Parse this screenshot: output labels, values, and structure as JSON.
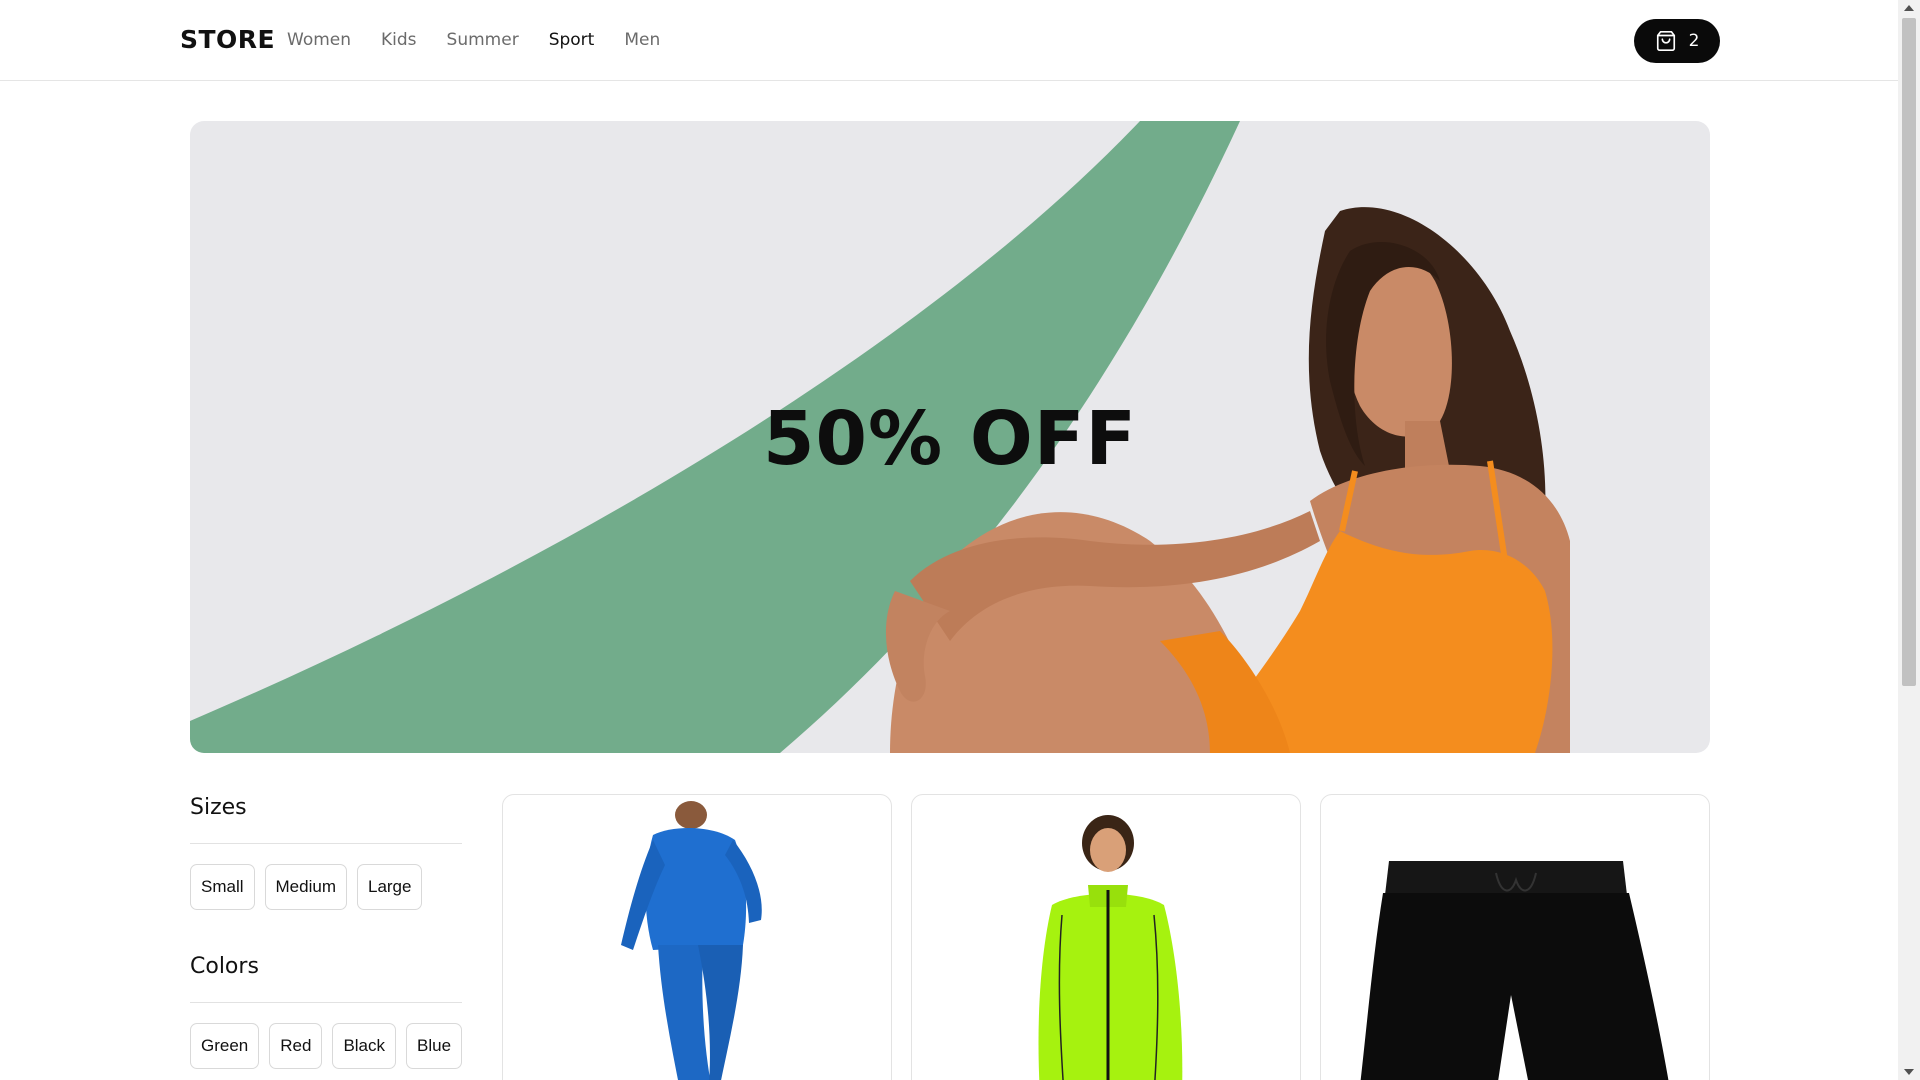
{
  "header": {
    "logo": "STORE",
    "nav": [
      {
        "label": "Women",
        "active": false
      },
      {
        "label": "Kids",
        "active": false
      },
      {
        "label": "Summer",
        "active": false
      },
      {
        "label": "Sport",
        "active": true
      },
      {
        "label": "Men",
        "active": false
      }
    ],
    "cart_count": "2",
    "cart_icon": "shopping-bag-icon"
  },
  "hero": {
    "headline": "50% OFF",
    "accent_color": "#72ac8b",
    "background_color": "#e8e8eb"
  },
  "filters": {
    "sizes": {
      "title": "Sizes",
      "options": [
        "Small",
        "Medium",
        "Large"
      ]
    },
    "colors": {
      "title": "Colors",
      "options": [
        "Green",
        "Red",
        "Black",
        "Blue"
      ]
    }
  },
  "products": [
    {
      "image": "blue-tracksuit-image",
      "color": "#1f6fd0"
    },
    {
      "image": "neon-green-jacket-image",
      "color": "#a6f20f"
    },
    {
      "image": "black-shorts-image",
      "color": "#0c0c0c"
    }
  ]
}
